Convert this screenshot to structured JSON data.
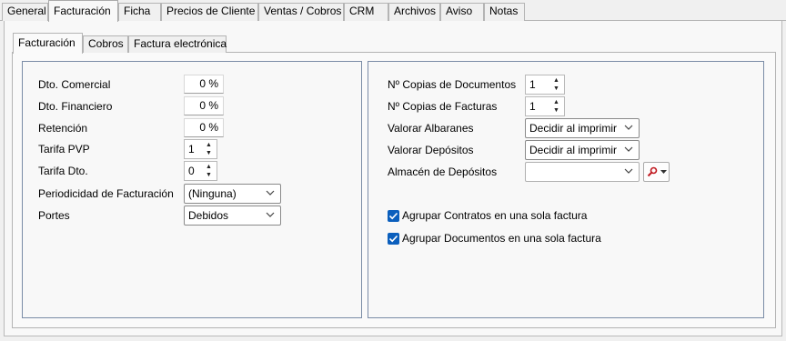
{
  "top_tabs": [
    "General",
    "Facturación",
    "Ficha",
    "Precios de Cliente",
    "Ventas / Cobros",
    "CRM",
    "Archivos",
    "Aviso",
    "Notas"
  ],
  "sub_tabs": [
    "Facturación",
    "Cobros",
    "Factura electrónica"
  ],
  "left": {
    "dto_comercial": {
      "label": "Dto. Comercial",
      "value": "0 %"
    },
    "dto_financiero": {
      "label": "Dto. Financiero",
      "value": "0 %"
    },
    "retencion": {
      "label": "Retención",
      "value": "0 %"
    },
    "tarifa_pvp": {
      "label": "Tarifa PVP",
      "value": "1"
    },
    "tarifa_dto": {
      "label": "Tarifa Dto.",
      "value": "0"
    },
    "periodicidad": {
      "label": "Periodicidad de Facturación",
      "value": "(Ninguna)"
    },
    "portes": {
      "label": "Portes",
      "value": "Debidos"
    }
  },
  "right": {
    "copias_documentos": {
      "label": "Nº Copias de Documentos",
      "value": "1"
    },
    "copias_facturas": {
      "label": "Nº Copias de Facturas",
      "value": "1"
    },
    "valorar_albaranes": {
      "label": "Valorar Albaranes",
      "value": "Decidir al imprimir"
    },
    "valorar_depositos": {
      "label": "Valorar Depósitos",
      "value": "Decidir al imprimir"
    },
    "almacen_depositos": {
      "label": "Almacén de Depósitos",
      "value": ""
    },
    "agrupar_contratos": {
      "label": "Agrupar Contratos en una sola factura",
      "checked": true
    },
    "agrupar_documentos": {
      "label": "Agrupar Documentos en una sola factura",
      "checked": true
    }
  },
  "icons": {
    "spin": "spin-arrows-icon",
    "chevron": "chevron-down-icon",
    "search": "search-icon",
    "check": "checkmark-icon"
  },
  "colors": {
    "accent": "#0b5fbd",
    "panel_border": "#7a8ca6"
  }
}
